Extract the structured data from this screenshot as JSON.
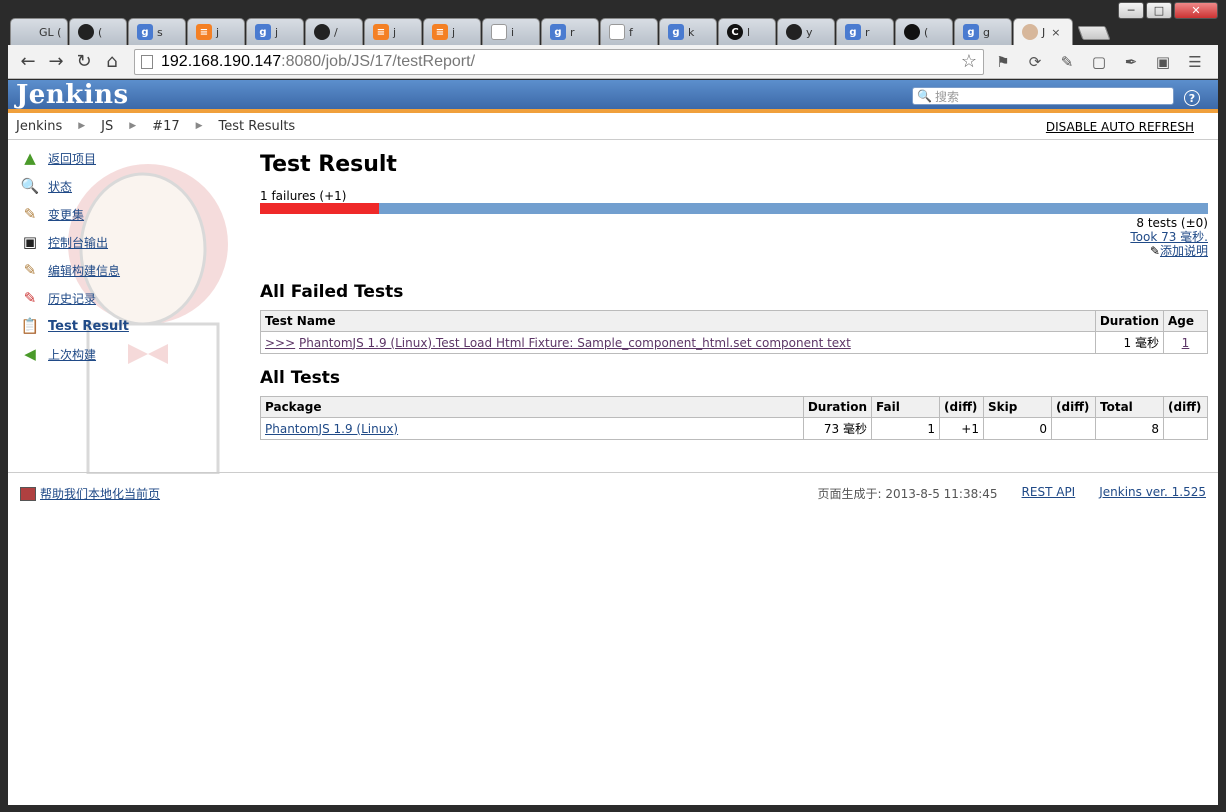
{
  "window": {
    "minimize": "─",
    "maximize": "□",
    "close": "✕"
  },
  "tabs": [
    {
      "icon": "gl",
      "label": "GL ("
    },
    {
      "icon": "github",
      "label": "("
    },
    {
      "icon": "google",
      "label": "s"
    },
    {
      "icon": "stackoverflow",
      "label": "j"
    },
    {
      "icon": "google",
      "label": "j"
    },
    {
      "icon": "github",
      "label": "/"
    },
    {
      "icon": "stackoverflow",
      "label": "j"
    },
    {
      "icon": "stackoverflow",
      "label": "j"
    },
    {
      "icon": "doc",
      "label": "i"
    },
    {
      "icon": "google",
      "label": "r"
    },
    {
      "icon": "doc",
      "label": "f"
    },
    {
      "icon": "google",
      "label": "k"
    },
    {
      "icon": "c",
      "label": "l"
    },
    {
      "icon": "github",
      "label": "y"
    },
    {
      "icon": "google",
      "label": "r"
    },
    {
      "icon": "circle",
      "label": "("
    },
    {
      "icon": "google",
      "label": "g"
    },
    {
      "icon": "jenkins",
      "label": "J",
      "active": true
    }
  ],
  "address": {
    "host": "192.168.190.147",
    "rest": ":8080/job/JS/17/testReport/"
  },
  "jenkins": {
    "logo": "Jenkins",
    "search_placeholder": "搜索",
    "help": "?"
  },
  "breadcrumb": [
    "Jenkins",
    "JS",
    "#17",
    "Test Results"
  ],
  "auto_refresh": "DISABLE AUTO REFRESH",
  "side_tasks": [
    {
      "icon": "up-arrow",
      "label": "返回项目"
    },
    {
      "icon": "magnifier",
      "label": "状态"
    },
    {
      "icon": "notepad",
      "label": "变更集"
    },
    {
      "icon": "terminal",
      "label": "控制台输出"
    },
    {
      "icon": "notepad",
      "label": "编辑构建信息"
    },
    {
      "icon": "notepad-history",
      "label": "历史记录"
    },
    {
      "icon": "clipboard",
      "label": "Test Result",
      "current": true
    },
    {
      "icon": "left-arrow",
      "label": "上次构建"
    }
  ],
  "result": {
    "title": "Test Result",
    "failures_text": "1 failures (+1)",
    "fail_fraction": 0.125,
    "tests_text": "8 tests (±0)",
    "took_text": "Took 73 毫秒.",
    "add_desc": "添加说明"
  },
  "failed": {
    "title": "All Failed Tests",
    "headers": [
      "Test Name",
      "Duration",
      "Age"
    ],
    "rows": [
      {
        "arrow": ">>>",
        "name": "PhantomJS 1.9 (Linux).Test Load Html Fixture: Sample_component_html.set component text",
        "duration": "1 毫秒",
        "age": "1"
      }
    ]
  },
  "all": {
    "title": "All Tests",
    "headers": [
      "Package",
      "Duration",
      "Fail",
      "(diff)",
      "Skip",
      "(diff)",
      "Total",
      "(diff)"
    ],
    "rows": [
      {
        "package": "PhantomJS 1.9 (Linux)",
        "duration": "73 毫秒",
        "fail": "1",
        "fail_diff": "+1",
        "skip": "0",
        "skip_diff": "",
        "total": "8",
        "total_diff": ""
      }
    ]
  },
  "footer": {
    "localize": "帮助我们本地化当前页",
    "generated": "页面生成于: 2013-8-5 11:38:45",
    "rest_api": "REST API",
    "version": "Jenkins ver. 1.525"
  }
}
